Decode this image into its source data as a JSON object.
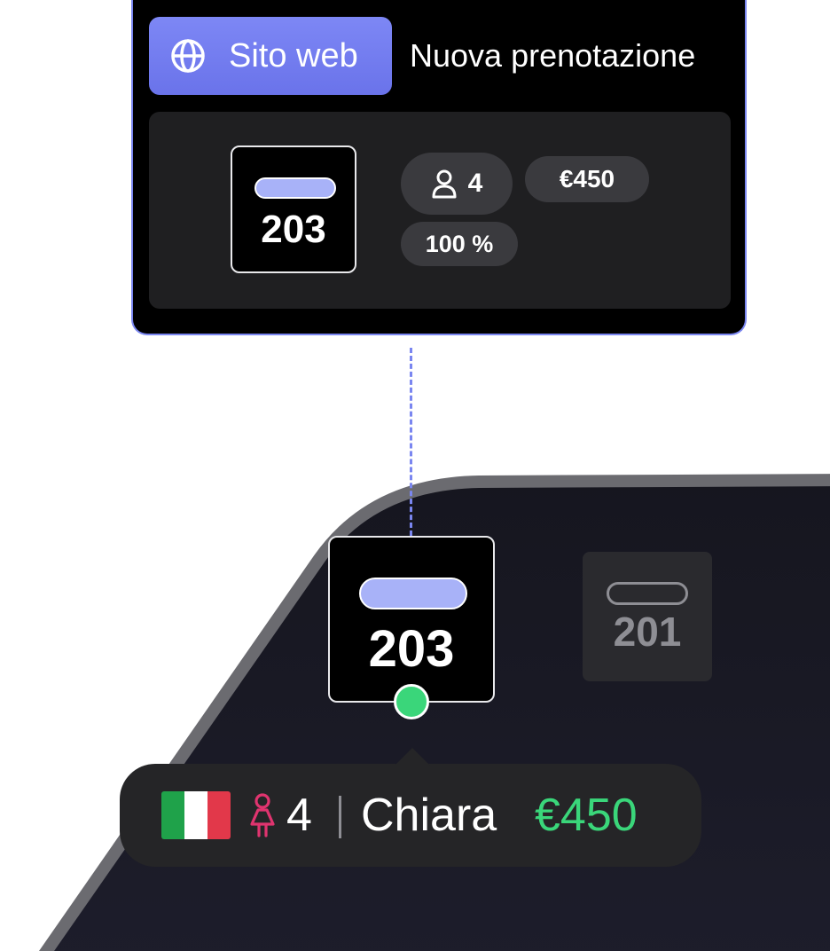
{
  "booking_card": {
    "source_label": "Sito web",
    "source_icon": "globe-icon",
    "title": "Nuova prenotazione",
    "room_number": "203",
    "guests": "4",
    "guests_icon": "user-icon",
    "price": "€450",
    "percent": "100 %"
  },
  "floor_plan": {
    "selected_room": {
      "number": "203",
      "status_color": "#3ad67a"
    },
    "other_room": {
      "number": "201"
    }
  },
  "guest_tag": {
    "flag": "italy-flag",
    "guest_icon": "female-guest-icon",
    "guest_count": "4",
    "name": "Chiara",
    "price": "€450"
  },
  "colors": {
    "accent": "#7a86f0",
    "bed_fill": "#a8b2f8",
    "available": "#3ad67a",
    "guest_icon": "#e0346f",
    "floor": "#14141d",
    "floor_border": "#6b6b70"
  }
}
